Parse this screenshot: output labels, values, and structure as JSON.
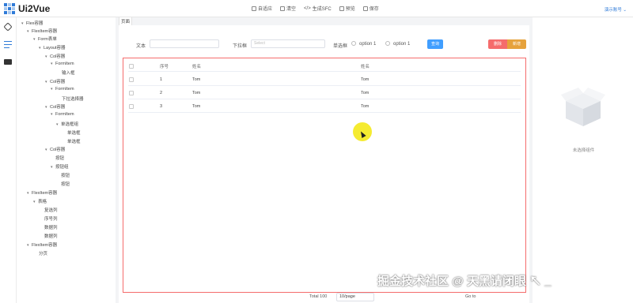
{
  "app": {
    "title": "Ui2Vue",
    "user": "演示账号 ⌄"
  },
  "toolbar": {
    "items": [
      "自适应",
      "清空",
      "生成SFC",
      "预览",
      "保存"
    ]
  },
  "tree": {
    "nodes": [
      "Flex容器",
      "FlexItem容器",
      "Form表单",
      "Layout容器",
      "Col容器",
      "FormItem",
      "输入框",
      "Col容器",
      "FormItem",
      "下拉选择器",
      "Col容器",
      "FormItem",
      "单选框组",
      "单选框",
      "单选框",
      "Col容器",
      "按钮",
      "按钮组",
      "按钮",
      "按钮",
      "FlexItem容器",
      "表格",
      "复选列",
      "序号列",
      "数据列",
      "数据列",
      "FlexItem容器",
      "分页"
    ]
  },
  "canvas": {
    "page_tag": "页面"
  },
  "form": {
    "text_label": "文本",
    "select_label": "下拉框",
    "select_placeholder": "Select",
    "radio_label": "单选框",
    "option1": "option 1",
    "option2": "option 1",
    "query_button": "查询",
    "delete_button": "删除",
    "add_button": "新增"
  },
  "table": {
    "headers": [
      "序号",
      "姓名",
      "姓名"
    ],
    "rows": [
      {
        "index": "1",
        "name": "Tom",
        "name2": "Tom"
      },
      {
        "index": "2",
        "name": "Tom",
        "name2": "Tom"
      },
      {
        "index": "3",
        "name": "Tom",
        "name2": "Tom"
      }
    ]
  },
  "pagination": {
    "total": "Total 100",
    "page_size": "10/page",
    "goto": "Go to"
  },
  "props_panel": {
    "empty_text": "未选择组件"
  },
  "watermark": "掘金技术社区 @ 天黑请闭眼 ↖ _",
  "colors": {
    "accent": "#2f7bd8",
    "danger": "#f56c6c",
    "warning": "#e6a23c",
    "primary_button": "#409eff"
  }
}
